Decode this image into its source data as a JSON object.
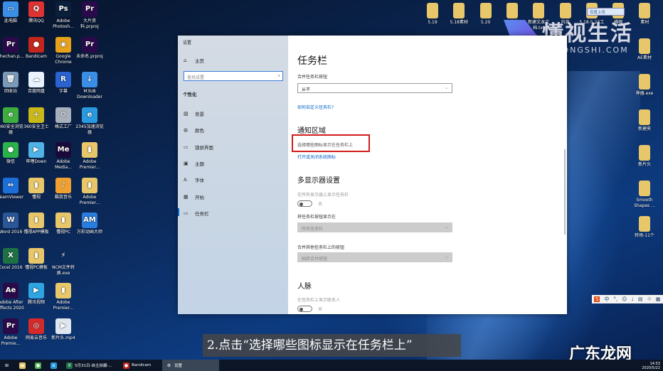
{
  "desktop": {
    "left_columns": [
      [
        {
          "label": "此电脑",
          "glyph": "▭",
          "color": "#3a8ee6"
        },
        {
          "label": "chechan.p...",
          "glyph": "Pr",
          "color": "#2a0a4a"
        },
        {
          "label": "回收站",
          "glyph": "🗑",
          "color": "#7a9ab8"
        },
        {
          "label": "360安全浏览器",
          "glyph": "e",
          "color": "#3fae3f"
        },
        {
          "label": "微信",
          "glyph": "●",
          "color": "#2bb34a"
        },
        {
          "label": "TeamViewer",
          "glyph": "⇔",
          "color": "#1c6fd8"
        },
        {
          "label": "Word 2016",
          "glyph": "W",
          "color": "#2b5797"
        },
        {
          "label": "Excel 2016",
          "glyph": "X",
          "color": "#1e7145"
        },
        {
          "label": "Adobe After Effects 2020",
          "glyph": "Ae",
          "color": "#2a0a4a"
        },
        {
          "label": "Adobe Premie...",
          "glyph": "Pr",
          "color": "#2a0a4a"
        }
      ],
      [
        {
          "label": "腾讯QQ",
          "glyph": "Q",
          "color": "#d33"
        },
        {
          "label": "Bandicam",
          "glyph": "●",
          "color": "#c2261c"
        },
        {
          "label": "百度网盘",
          "glyph": "☁",
          "color": "#e9f3ff"
        },
        {
          "label": "360安全卫士",
          "glyph": "+",
          "color": "#c9b81a"
        },
        {
          "label": "哔哩Down",
          "glyph": "▶",
          "color": "#4fb3e8"
        },
        {
          "label": "懂视",
          "glyph": "▮",
          "color": "#e8c66a"
        },
        {
          "label": "懂视APP模板",
          "glyph": "▮",
          "color": "#e8c66a"
        },
        {
          "label": "懂视PC模板",
          "glyph": "▮",
          "color": "#e8c66a"
        },
        {
          "label": "腾讯视频",
          "glyph": "▶",
          "color": "#2fa4e0"
        },
        {
          "label": "网易云音乐",
          "glyph": "◎",
          "color": "#d42a2a"
        }
      ],
      [
        {
          "label": "Adobe Photosh...",
          "glyph": "Ps",
          "color": "#0a1f3a"
        },
        {
          "label": "Google Chrome",
          "glyph": "◉",
          "color": "#e8a21a"
        },
        {
          "label": "字幕",
          "glyph": "R",
          "color": "#2a63d0"
        },
        {
          "label": "格式工厂",
          "glyph": "⚙",
          "color": "#a8b0bc"
        },
        {
          "label": "Adobe Media...",
          "glyph": "Me",
          "color": "#1a0a3a"
        },
        {
          "label": "酷我音乐",
          "glyph": "♪",
          "color": "#f0a030"
        },
        {
          "label": "懂视PC",
          "glyph": "▮",
          "color": "#e8c66a"
        },
        {
          "label": "NCM文件转换.exe",
          "glyph": "⚡",
          "color": "transparent"
        },
        {
          "label": "Adobe Premier...",
          "glyph": "▮",
          "color": "#e8c66a"
        },
        {
          "label": "新片头.mp4",
          "glyph": "▶",
          "color": "#dfe6ee"
        }
      ],
      [
        {
          "label": "大片资料.prproj",
          "glyph": "Pr",
          "color": "#2a0a4a"
        },
        {
          "label": "未命名.prproj",
          "glyph": "Pr",
          "color": "#2a0a4a"
        },
        {
          "label": "M3U8 Downloader",
          "glyph": "↓",
          "color": "#3a8ee6"
        },
        {
          "label": "2345加速浏览器",
          "glyph": "e",
          "color": "#2a9ae0"
        },
        {
          "label": "Adobe Premier...",
          "glyph": "▮",
          "color": "#e8c66a"
        },
        {
          "label": "Adobe Premier...",
          "glyph": "▮",
          "color": "#e8c66a"
        },
        {
          "label": "万彩动画大师",
          "glyph": "AM",
          "color": "#2a7de0"
        }
      ]
    ],
    "top_row": [
      {
        "label": "5.19"
      },
      {
        "label": "5.18素材"
      },
      {
        "label": "5.20"
      },
      {
        "label": "合伙人"
      },
      {
        "label": "新建文本文档.txt"
      },
      {
        "label": "内容"
      },
      {
        "label": "5.18-5.23工"
      },
      {
        "label": "横幅"
      },
      {
        "label": "素材"
      }
    ],
    "right_column": [
      {
        "label": "AE素材"
      },
      {
        "label": "神器.exe"
      },
      {
        "label": "新建夹"
      },
      {
        "label": "新片头"
      },
      {
        "label": "Smooth Shapes ..."
      },
      {
        "label": "转场-11个"
      }
    ],
    "badge": "百度上传"
  },
  "settings": {
    "window_title": "设置",
    "home": "主页",
    "search_placeholder": "查找设置",
    "section": "个性化",
    "nav": [
      {
        "label": "背景",
        "icon": "▨"
      },
      {
        "label": "颜色",
        "icon": "◍"
      },
      {
        "label": "锁屏界面",
        "icon": "▭"
      },
      {
        "label": "主题",
        "icon": "▣"
      },
      {
        "label": "字体",
        "icon": "A"
      },
      {
        "label": "开始",
        "icon": "▦"
      },
      {
        "label": "任务栏",
        "icon": "▭"
      }
    ],
    "page_title": "任务栏",
    "combine_label": "合并任务栏按钮",
    "combine_value": "从不",
    "customize_link": "如何自定义任务栏?",
    "notify_heading": "通知区域",
    "notify_link1": "选择哪些图标显示在任务栏上",
    "notify_link2": "打开或关闭系统图标",
    "multi_heading": "多显示器设置",
    "multi_show_label": "在所有显示器上显示任务栏",
    "toggle_off": "关",
    "show_buttons_label": "将任务栏按钮显示在",
    "show_buttons_value": "所有任务栏",
    "combine_other_label": "合并其他任务栏上的按钮",
    "combine_other_value": "始终合并按钮",
    "people_heading": "人脉",
    "people_label": "在任务栏上显示联系人"
  },
  "caption": "2.点击“选择哪些图标显示在任务栏上”",
  "watermark": {
    "brand": "懂视生活",
    "site": "51DONGSHI.COM",
    "corner": "广东龙网"
  },
  "taskbar": {
    "items": [
      {
        "label": "",
        "glyph": "⊞",
        "color": "transparent"
      },
      {
        "label": "",
        "glyph": "▬",
        "color": "#e8c66a"
      },
      {
        "label": "",
        "glyph": "●",
        "color": "#4caf50"
      },
      {
        "label": "",
        "glyph": "e",
        "color": "#2a9ae0"
      },
      {
        "label": "5月31日-自主拍摄-...",
        "glyph": "X",
        "color": "#1e7145"
      },
      {
        "label": "Bandicam",
        "glyph": "●",
        "color": "#c2261c"
      },
      {
        "label": "设置",
        "glyph": "⚙",
        "color": "transparent"
      }
    ],
    "time": "14:53",
    "date": "2020/5/22",
    "ime": "中"
  }
}
